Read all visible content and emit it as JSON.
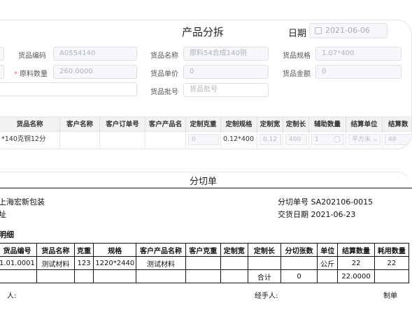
{
  "form": {
    "title": "产品分拆",
    "date_label": "日期",
    "date_value": "2021-06-06",
    "fields": [
      {
        "label": "货品编码",
        "value": "A0554140",
        "required": false
      },
      {
        "label": "货品名称",
        "value": "原料54合成140铜",
        "required": false
      },
      {
        "label": "货品规格",
        "value": "1.07*400",
        "required": false
      },
      {
        "label": "原料数量",
        "value": "260.0000",
        "required": true
      },
      {
        "label": "货品单价",
        "value": "0",
        "required": false
      },
      {
        "label": "货品金额",
        "value": "0",
        "required": false
      },
      {
        "label": "货品批号",
        "value": "",
        "placeholder": "货品批号",
        "required": false
      }
    ],
    "req_mark": "*"
  },
  "detail_table": {
    "headers": [
      "货品名称",
      "客户名称",
      "客户订单号",
      "客户产品名",
      "定制克重",
      "定制规格",
      "定制宽",
      "定制长",
      "辅助数量",
      "结算单位",
      "结算数"
    ],
    "row": {
      "name": "*140克铜12分",
      "weight": "0",
      "spec": "0.12*400",
      "width": "0.12",
      "length": "400",
      "aux_qty": "1",
      "unit": "平方米",
      "settle_qty": "48"
    }
  },
  "sheet": {
    "title": "分切单",
    "customer": "上海宏新包装",
    "address_label": "址",
    "order_no_label": "分切单号",
    "order_no": "SA202106-0015",
    "delivery_label": "交货日期",
    "delivery_date": "2021-06-23",
    "section_title": "明细",
    "headers": [
      "货品编号",
      "货品名称",
      "克重",
      "规格",
      "客户产品名称",
      "客户克重",
      "定制宽",
      "定制长",
      "分切张数",
      "单位",
      "结算数量",
      "耗用数量"
    ],
    "rows": [
      [
        "1.01.0001",
        "测试材料",
        "123",
        "1220*2440",
        "测试材料",
        "",
        "",
        "",
        "",
        "公斤",
        "22",
        "22"
      ],
      [
        "",
        "",
        "",
        "",
        "",
        "",
        "",
        "合计",
        "0",
        "",
        "22.0000",
        ""
      ]
    ],
    "footer": {
      "left": "人:",
      "middle": "经手人:",
      "right": "制单"
    }
  }
}
